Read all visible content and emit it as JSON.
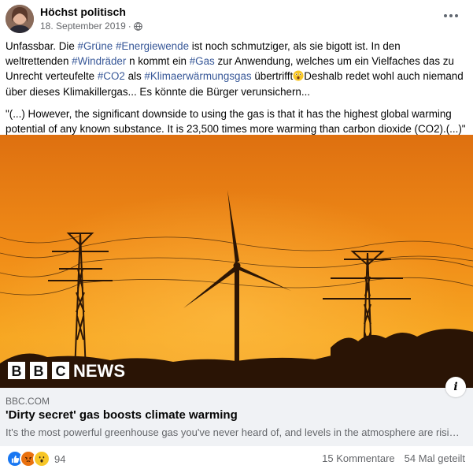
{
  "post": {
    "author": "Höchst politisch",
    "date": "18. September 2019",
    "date_suffix": " · ",
    "privacy_icon": "globe-icon",
    "text": {
      "line1_a": "Unfassbar. Die ",
      "tag_gruene": "#Grüne",
      "tag_energiewende": "#Energiewende",
      "line1_b": " ist noch schmutziger, als sie bigott ist. In den weltrettenden ",
      "tag_windraeder": "#Windräder",
      "line2_a": " n kommt ein ",
      "tag_gas": "#Gas",
      "line2_b": " zur Anwendung, welches um ein Vielfaches das zu Unrecht verteufelte ",
      "tag_co2": "#CO2",
      "line3_a": " als ",
      "tag_klima": "#Klimaerwärmungsgas",
      "line3_b": " übertrifft",
      "emoji": "astonished-face",
      "line3_c": "Deshalb redet wohl auch niemand über dieses Klimakillergas... Es könnte die Bürger verunsichern...",
      "quote": "\"(...) However, the significant downside to using the gas is that it has the highest global warming potential of any known substance. It is 23,500 times more warming than carbon dioxide (CO2).(...)\""
    }
  },
  "link": {
    "image_logo_boxes": [
      "B",
      "B",
      "C"
    ],
    "image_logo_word": "NEWS",
    "info_icon": "i",
    "domain": "BBC.COM",
    "title": "'Dirty secret' gas boosts climate warming",
    "description": "It's the most powerful greenhouse gas you've never heard of, and levels in the atmosphere are rising fast."
  },
  "footer": {
    "reactions": [
      "like-icon",
      "angry-icon",
      "wow-icon"
    ],
    "reaction_count": "94",
    "comments": "15 Kommentare",
    "shares": "54 Mal geteilt"
  },
  "colors": {
    "link_blue": "#385898",
    "muted": "#65676b",
    "sky_top": "#e0740f",
    "sky_mid": "#f59a1c",
    "like_blue": "#1877f2",
    "angry_orange": "#e9710f"
  }
}
